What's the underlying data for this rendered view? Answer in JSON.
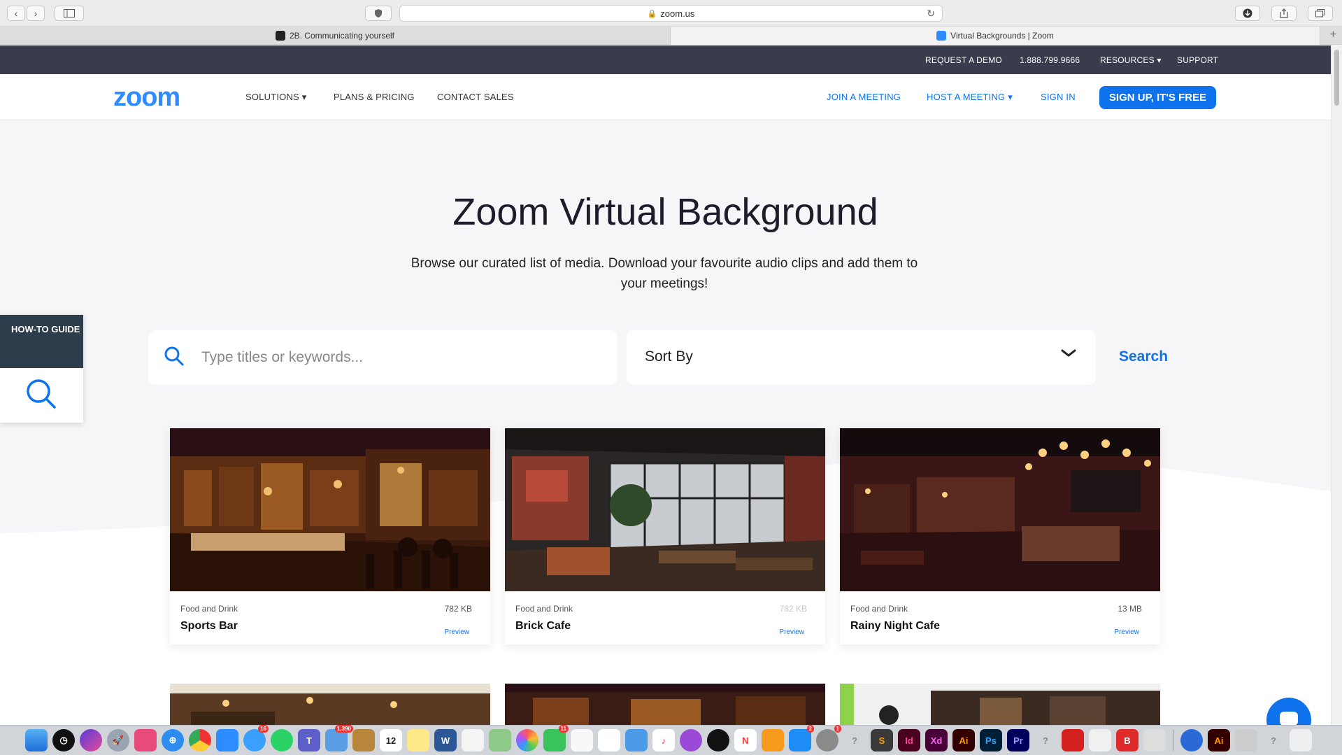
{
  "browser": {
    "url": "zoom.us",
    "tabs": [
      {
        "label": "2B. Communicating yourself"
      },
      {
        "label": "Virtual Backgrounds | Zoom"
      }
    ]
  },
  "topbar": {
    "request_demo": "REQUEST A DEMO",
    "phone": "1.888.799.9666",
    "resources": "RESOURCES",
    "support": "SUPPORT"
  },
  "nav": {
    "logo": "zoom",
    "solutions": "SOLUTIONS",
    "plans": "PLANS & PRICING",
    "contact": "CONTACT SALES",
    "join": "JOIN A MEETING",
    "host": "HOST A MEETING",
    "signin": "SIGN IN",
    "signup": "SIGN UP, IT'S FREE"
  },
  "hero": {
    "title": "Zoom Virtual Background",
    "subtitle": "Browse our curated list of media. Download your favourite audio clips and add them to your meetings!"
  },
  "filters": {
    "search_placeholder": "Type titles or keywords...",
    "sort_label": "Sort By",
    "search_button": "Search"
  },
  "howto": {
    "label": "HOW-TO GUIDE"
  },
  "cards": [
    {
      "category": "Food and Drink",
      "size": "782 KB",
      "name": "Sports Bar",
      "preview": "Preview"
    },
    {
      "category": "Food and Drink",
      "size": "782 KB",
      "name": "Brick Cafe",
      "preview": "Preview"
    },
    {
      "category": "Food and Drink",
      "size": "13 MB",
      "name": "Rainy Night Cafe",
      "preview": "Preview"
    }
  ],
  "dock": {
    "calendar_day": "12",
    "badges": {
      "messages": "16",
      "mail": "1,390",
      "facetime": "11",
      "appstore": "2",
      "settings": "1"
    },
    "labels": {
      "indesign": "Id",
      "xd": "Xd",
      "illustrator": "Ai",
      "photoshop": "Ps",
      "premiere": "Pr",
      "brave": "B",
      "illustrator2": "Ai"
    }
  },
  "colors": {
    "accent": "#0e72ed",
    "topbar": "#393c4c",
    "logo": "#2d8cff",
    "howto": "#2d3d4c"
  }
}
